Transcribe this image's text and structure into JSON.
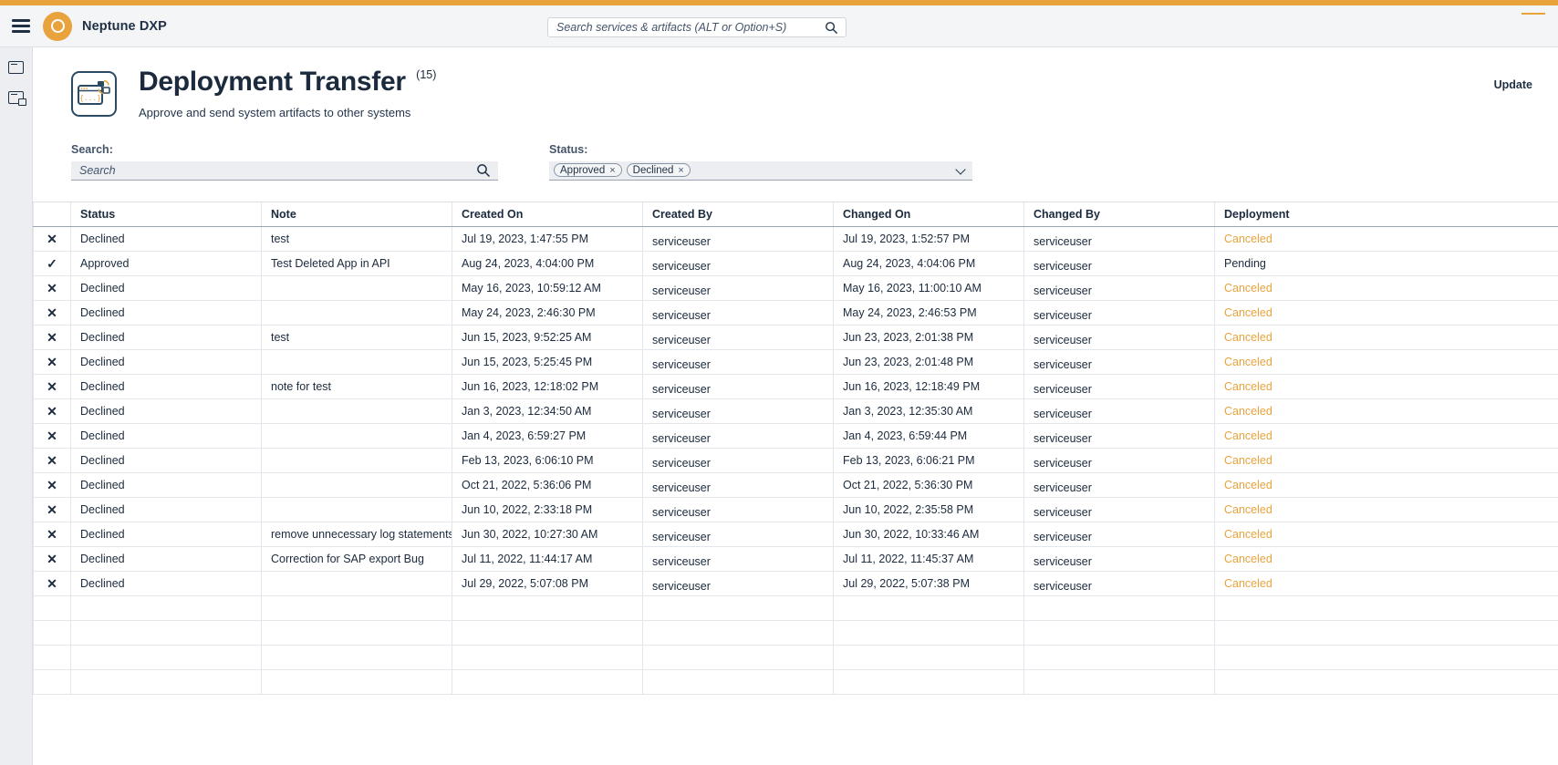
{
  "header": {
    "brand": "Neptune DXP",
    "menu_icon": "hamburger-icon",
    "logo_icon": "neptune-logo-icon",
    "search_placeholder": "Search services & artifacts (ALT or Option+S)",
    "search_value": "",
    "search_icon": "search-icon"
  },
  "rail": {
    "items": [
      {
        "icon": "window-icon",
        "label": ""
      },
      {
        "icon": "window-transfer-icon",
        "label": ""
      }
    ]
  },
  "page": {
    "icon": "deployment-transfer-icon",
    "title": "Deployment Transfer",
    "count": "(15)",
    "subtitle": "Approve and send system artifacts to other systems",
    "update_label": "Update"
  },
  "filters": {
    "search_label": "Search:",
    "search_placeholder": "Search",
    "search_value": "",
    "status_label": "Status:",
    "status_tags": [
      {
        "label": "Approved",
        "remove": "×"
      },
      {
        "label": "Declined",
        "remove": "×"
      }
    ]
  },
  "table": {
    "columns": [
      "",
      "Status",
      "Note",
      "Created On",
      "Created By",
      "Changed On",
      "Changed By",
      "Deployment"
    ],
    "rows": [
      {
        "mark": "✕",
        "status": "Declined",
        "note": "test",
        "created_on": "Jul 19, 2023, 1:47:55 PM",
        "created_by": "serviceuser",
        "changed_on": "Jul 19, 2023, 1:52:57 PM",
        "changed_by": "serviceuser",
        "deployment": "Canceled",
        "deployment_state": "canceled"
      },
      {
        "mark": "✓",
        "status": "Approved",
        "note": "Test Deleted App in API",
        "created_on": "Aug 24, 2023, 4:04:00 PM",
        "created_by": "serviceuser",
        "changed_on": "Aug 24, 2023, 4:04:06 PM",
        "changed_by": "serviceuser",
        "deployment": "Pending",
        "deployment_state": "pending"
      },
      {
        "mark": "✕",
        "status": "Declined",
        "note": "",
        "created_on": "May 16, 2023, 10:59:12 AM",
        "created_by": "serviceuser",
        "changed_on": "May 16, 2023, 11:00:10 AM",
        "changed_by": "serviceuser",
        "deployment": "Canceled",
        "deployment_state": "canceled"
      },
      {
        "mark": "✕",
        "status": "Declined",
        "note": "",
        "created_on": "May 24, 2023, 2:46:30 PM",
        "created_by": "serviceuser",
        "changed_on": "May 24, 2023, 2:46:53 PM",
        "changed_by": "serviceuser",
        "deployment": "Canceled",
        "deployment_state": "canceled"
      },
      {
        "mark": "✕",
        "status": "Declined",
        "note": "test",
        "created_on": "Jun 15, 2023, 9:52:25 AM",
        "created_by": "serviceuser",
        "changed_on": "Jun 23, 2023, 2:01:38 PM",
        "changed_by": "serviceuser",
        "deployment": "Canceled",
        "deployment_state": "canceled"
      },
      {
        "mark": "✕",
        "status": "Declined",
        "note": "",
        "created_on": "Jun 15, 2023, 5:25:45 PM",
        "created_by": "serviceuser",
        "changed_on": "Jun 23, 2023, 2:01:48 PM",
        "changed_by": "serviceuser",
        "deployment": "Canceled",
        "deployment_state": "canceled"
      },
      {
        "mark": "✕",
        "status": "Declined",
        "note": "note for test",
        "created_on": "Jun 16, 2023, 12:18:02 PM",
        "created_by": "serviceuser",
        "changed_on": "Jun 16, 2023, 12:18:49 PM",
        "changed_by": "serviceuser",
        "deployment": "Canceled",
        "deployment_state": "canceled"
      },
      {
        "mark": "✕",
        "status": "Declined",
        "note": "",
        "created_on": "Jan 3, 2023, 12:34:50 AM",
        "created_by": "serviceuser",
        "changed_on": "Jan 3, 2023, 12:35:30 AM",
        "changed_by": "serviceuser",
        "deployment": "Canceled",
        "deployment_state": "canceled"
      },
      {
        "mark": "✕",
        "status": "Declined",
        "note": "",
        "created_on": "Jan 4, 2023, 6:59:27 PM",
        "created_by": "serviceuser",
        "changed_on": "Jan 4, 2023, 6:59:44 PM",
        "changed_by": "serviceuser",
        "deployment": "Canceled",
        "deployment_state": "canceled"
      },
      {
        "mark": "✕",
        "status": "Declined",
        "note": "",
        "created_on": "Feb 13, 2023, 6:06:10 PM",
        "created_by": "serviceuser",
        "changed_on": "Feb 13, 2023, 6:06:21 PM",
        "changed_by": "serviceuser",
        "deployment": "Canceled",
        "deployment_state": "canceled"
      },
      {
        "mark": "✕",
        "status": "Declined",
        "note": "",
        "created_on": "Oct 21, 2022, 5:36:06 PM",
        "created_by": "serviceuser",
        "changed_on": "Oct 21, 2022, 5:36:30 PM",
        "changed_by": "serviceuser",
        "deployment": "Canceled",
        "deployment_state": "canceled"
      },
      {
        "mark": "✕",
        "status": "Declined",
        "note": "",
        "created_on": "Jun 10, 2022, 2:33:18 PM",
        "created_by": "serviceuser",
        "changed_on": "Jun 10, 2022, 2:35:58 PM",
        "changed_by": "serviceuser",
        "deployment": "Canceled",
        "deployment_state": "canceled"
      },
      {
        "mark": "✕",
        "status": "Declined",
        "note": "remove unnecessary log statements",
        "created_on": "Jun 30, 2022, 10:27:30 AM",
        "created_by": "serviceuser",
        "changed_on": "Jun 30, 2022, 10:33:46 AM",
        "changed_by": "serviceuser",
        "deployment": "Canceled",
        "deployment_state": "canceled"
      },
      {
        "mark": "✕",
        "status": "Declined",
        "note": "Correction for SAP export Bug",
        "created_on": "Jul 11, 2022, 11:44:17 AM",
        "created_by": "serviceuser",
        "changed_on": "Jul 11, 2022, 11:45:37 AM",
        "changed_by": "serviceuser",
        "deployment": "Canceled",
        "deployment_state": "canceled"
      },
      {
        "mark": "✕",
        "status": "Declined",
        "note": "",
        "created_on": "Jul 29, 2022, 5:07:08 PM",
        "created_by": "serviceuser",
        "changed_on": "Jul 29, 2022, 5:07:38 PM",
        "changed_by": "serviceuser",
        "deployment": "Canceled",
        "deployment_state": "canceled"
      }
    ],
    "empty_rows": 4
  },
  "colors": {
    "accent": "#e8a33d",
    "navy": "#1b2a3d",
    "header_bg": "#f4f5f7",
    "field_bg": "#eceef1"
  }
}
